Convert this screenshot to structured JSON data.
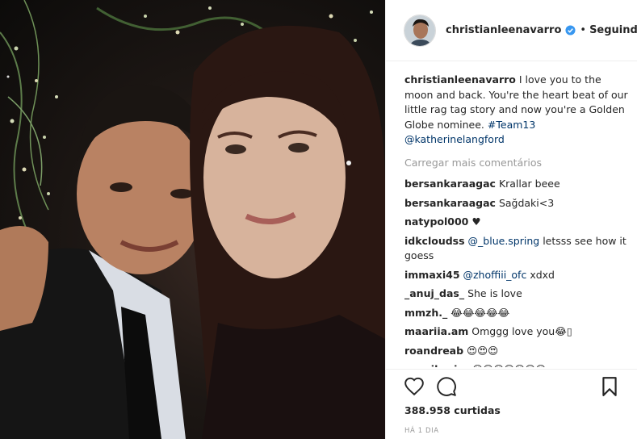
{
  "post": {
    "username": "christianleenavarro",
    "verified_icon": "verified-badge-icon",
    "separator": "•",
    "follow_status": "Seguindo"
  },
  "caption": {
    "username": "christianleenavarro",
    "text": "I love you to the moon and back. You're the heart beat of our little rag tag story and now you're a Golden Globe nominee.",
    "hashtag": "#Team13",
    "mention": "@katherinelangford"
  },
  "load_more": "Carregar mais comentários",
  "comments": [
    {
      "user": "bersankaraagac",
      "text": "Krallar beee"
    },
    {
      "user": "bersankaraagac",
      "text": "Sağdaki<3"
    },
    {
      "user": "natypol000",
      "text": "♥"
    },
    {
      "user": "idkcloudss",
      "mention": "@_blue.spring",
      "text": "letsss see how it goess"
    },
    {
      "user": "immaxi45",
      "mention": "@zhoffiii_ofc",
      "text": "xdxd"
    },
    {
      "user": "_anuj_das_",
      "text": "She is love"
    },
    {
      "user": "mmzh._",
      "text": "😂😂😂😂😂"
    },
    {
      "user": "maariia.am",
      "text": "Omggg love you😂▯"
    },
    {
      "user": "roandreab",
      "text": "😍😍😍"
    },
    {
      "user": "zeynikosire",
      "text": "😍😍😍😍😍😍😍"
    }
  ],
  "actions": {
    "like_icon": "heart-icon",
    "comment_icon": "comment-icon",
    "save_icon": "bookmark-icon"
  },
  "likes": "388.958 curtidas",
  "timestamp": "HÁ 1 DIA",
  "colors": {
    "text": "#262626",
    "link": "#003569",
    "muted": "#999999",
    "verified": "#3897f0",
    "border": "#efefef"
  }
}
